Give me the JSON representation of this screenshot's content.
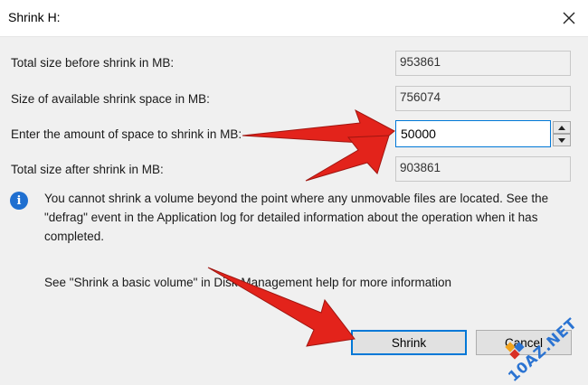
{
  "window": {
    "title": "Shrink H:",
    "close_icon": "close-icon"
  },
  "fields": {
    "total_before": {
      "label": "Total size before shrink in MB:",
      "value": "953861"
    },
    "available": {
      "label": "Size of available shrink space in MB:",
      "value": "756074"
    },
    "amount": {
      "label": "Enter the amount of space to shrink in MB:",
      "value": "50000"
    },
    "total_after": {
      "label": "Total size after shrink in MB:",
      "value": "903861"
    }
  },
  "info": {
    "icon": "info-icon",
    "text": "You cannot shrink a volume beyond the point where any unmovable files are located. See the \"defrag\" event in the Application log for detailed information about the operation when it has completed."
  },
  "help": {
    "text": "See \"Shrink a basic volume\" in Disk Management help for more information"
  },
  "buttons": {
    "shrink": "Shrink",
    "cancel": "Cancel"
  },
  "watermark": {
    "text": "10AZ.NET"
  },
  "colors": {
    "accent": "#0078d7",
    "arrow": "#e3231b",
    "info": "#1f6fd0"
  }
}
